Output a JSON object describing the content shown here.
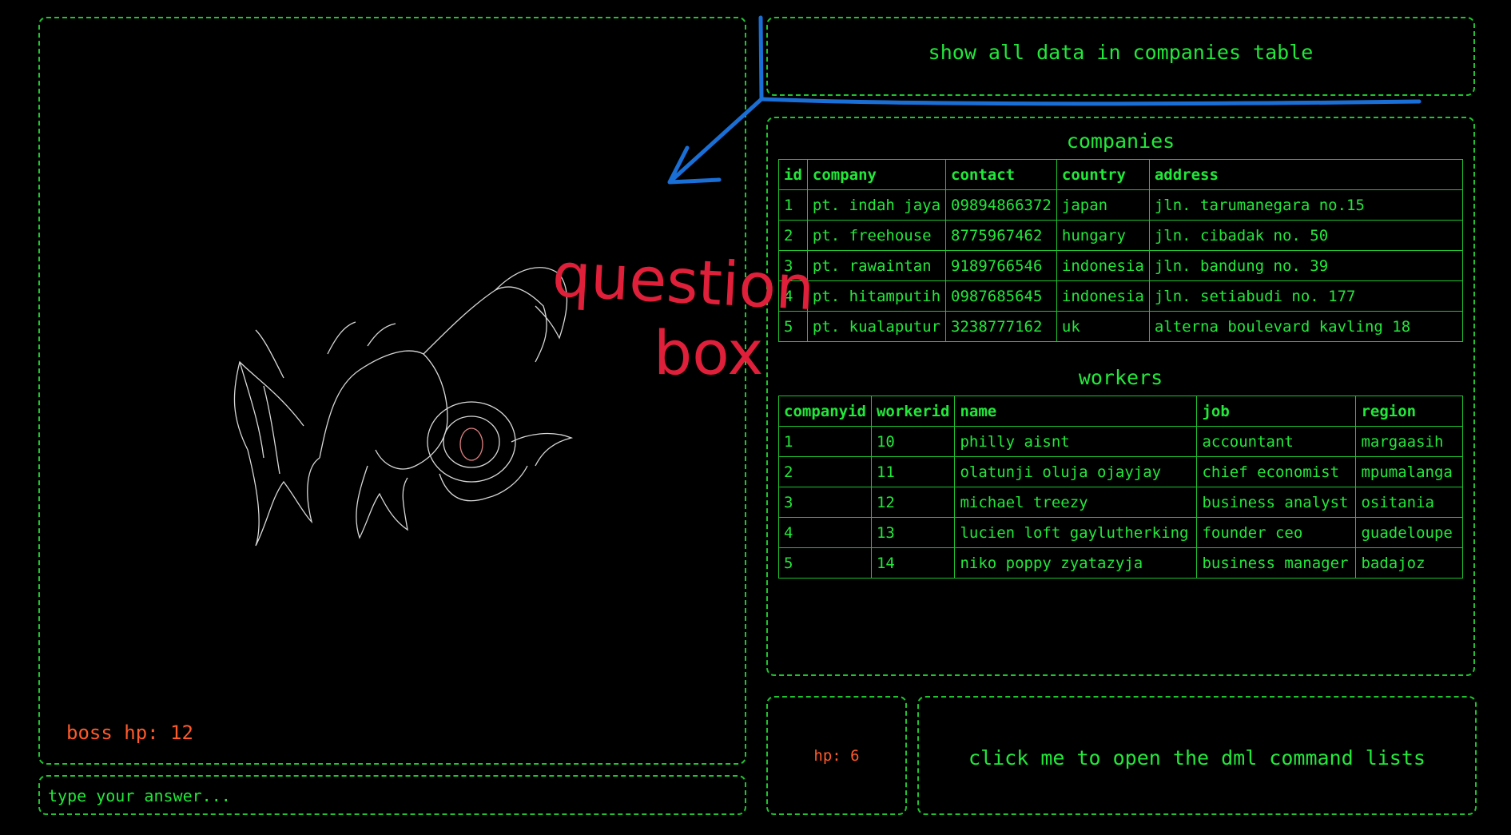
{
  "question": {
    "text": "show all data in companies table"
  },
  "boss": {
    "hp_label": "boss hp: 12"
  },
  "answer": {
    "placeholder": "type your answer..."
  },
  "player": {
    "hp_label": "hp: 6"
  },
  "dml": {
    "label": "click me to open the dml command lists"
  },
  "companies": {
    "title": "companies",
    "headers": [
      "id",
      "company",
      "contact",
      "country",
      "address"
    ],
    "rows": [
      [
        "1",
        "pt. indah jaya",
        "09894866372",
        "japan",
        "jln. tarumanegara no.15"
      ],
      [
        "2",
        "pt. freehouse",
        "8775967462",
        "hungary",
        "jln. cibadak no. 50"
      ],
      [
        "3",
        "pt. rawaintan",
        "9189766546",
        "indonesia",
        "jln. bandung no. 39"
      ],
      [
        "4",
        "pt. hitamputih",
        "0987685645",
        "indonesia",
        "jln. setiabudi no. 177"
      ],
      [
        "5",
        "pt. kualaputur",
        "3238777162",
        "uk",
        "alterna boulevard kavling 18"
      ]
    ]
  },
  "workers": {
    "title": "workers",
    "headers": [
      "companyid",
      "workerid",
      "name",
      "job",
      "region"
    ],
    "rows": [
      [
        "1",
        "10",
        "philly aisnt",
        "accountant",
        "margaasih"
      ],
      [
        "2",
        "11",
        "olatunji oluja ojayjay",
        "chief economist",
        "mpumalanga"
      ],
      [
        "3",
        "12",
        "michael treezy",
        "business analyst",
        "ositania"
      ],
      [
        "4",
        "13",
        "lucien loft gaylutherking",
        "founder ceo",
        "guadeloupe"
      ],
      [
        "5",
        "14",
        "niko poppy zyatazyja",
        "business manager",
        "badajoz"
      ]
    ]
  },
  "annotation": {
    "line1": "question",
    "line2": "box"
  },
  "colors": {
    "accent": "#22e83a",
    "hp": "#ff5a2a",
    "annotation_red": "#e0203a",
    "annotation_blue": "#1a6fd6"
  }
}
